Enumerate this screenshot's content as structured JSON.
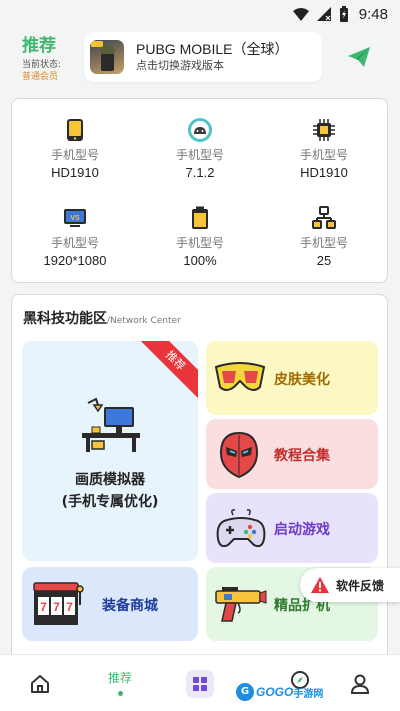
{
  "status_bar": {
    "time": "9:48"
  },
  "header": {
    "title": "推荐",
    "state_label": "当前状态:",
    "state_value": "普通会员",
    "game": {
      "name": "PUBG MOBILE（全球）",
      "subtitle": "点击切换游戏版本"
    }
  },
  "device_info": [
    {
      "icon": "phone-yellow-icon",
      "label": "手机型号",
      "value": "HD1910"
    },
    {
      "icon": "android-icon",
      "label": "手机型号",
      "value": "7.1.2"
    },
    {
      "icon": "cpu-chip-icon",
      "label": "手机型号",
      "value": "HD1910"
    },
    {
      "icon": "monitor-vs-icon",
      "label": "手机型号",
      "value": "1920*1080"
    },
    {
      "icon": "battery-icon",
      "label": "手机型号",
      "value": "100%"
    },
    {
      "icon": "network-tree-icon",
      "label": "手机型号",
      "value": "25"
    }
  ],
  "tech": {
    "title": "黑科技功能区",
    "subtitle": "/Network Center",
    "big_tile": {
      "line1": "画质模拟器",
      "line2": "(手机专属优化)",
      "ribbon": "推荐"
    },
    "tiles": {
      "skin": "皮肤美化",
      "tutorial": "教程合集",
      "launch": "启动游戏",
      "shop": "装备商城",
      "weapon": "精品扩机"
    }
  },
  "feedback": {
    "label": "软件反馈"
  },
  "bottom_nav": {
    "recommend": "推荐",
    "watermark_prefix": "GOGO",
    "watermark_suffix": "手游网"
  },
  "colors": {
    "accent_green": "#3eb86e",
    "member_orange": "#e08a2c",
    "ribbon_red": "#e8343a"
  }
}
